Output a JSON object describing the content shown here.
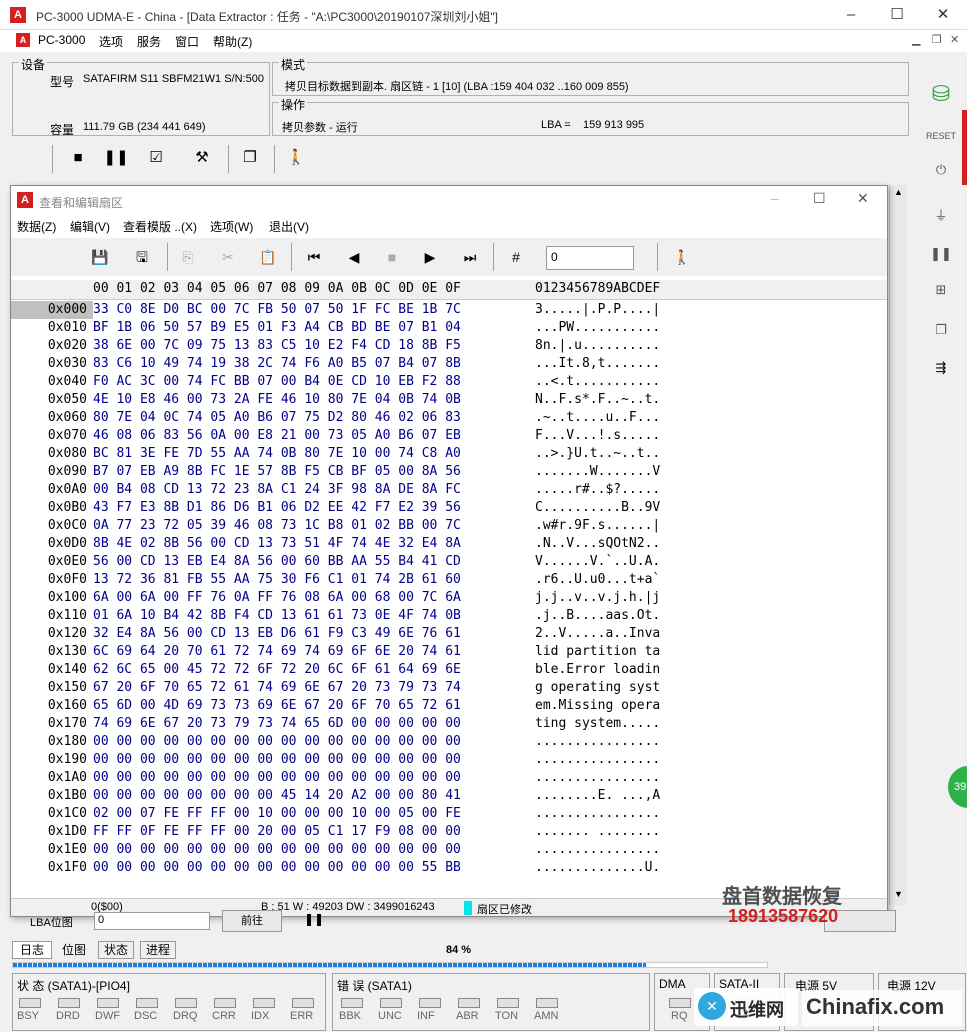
{
  "window": {
    "title": "PC-3000 UDMA-E - China - [Data Extractor : 任务 - \"A:\\PC3000\\20190107深圳刘小姐\"]",
    "logo": "A"
  },
  "menu": {
    "app": "PC-3000",
    "items": [
      "选项",
      "服务",
      "窗口",
      "帮助(Z)"
    ]
  },
  "device": {
    "label": "设备",
    "model_label": "型号",
    "model": "SATAFIRM   S11 SBFM21W1 S/N:500",
    "capacity_label": "容量",
    "capacity": "111.79 GB (234 441 649)"
  },
  "mode": {
    "label": "模式",
    "text": "拷贝目标数据到副本. 扇区链 - 1 [10] (LBA :159 404 032 ..160 009 855)"
  },
  "operation": {
    "label": "操作",
    "text": "拷贝参数 - 运行",
    "lba_label": "LBA =",
    "lba": "159 913 995"
  },
  "editor": {
    "title": "查看和编辑扇区",
    "menu": [
      "数据(Z)",
      "编辑(V)",
      "查看模版 ..(X)",
      "选项(W)",
      "退出(V)"
    ],
    "sector_input": "0",
    "header_hex": "00 01 02 03 04 05 06 07 08 09 0A 0B 0C 0D 0E 0F",
    "header_ascii": "0123456789ABCDEF",
    "rows": [
      {
        "off": "0x000",
        "hex": "33 C0 8E D0 BC 00 7C FB 50 07 50 1F FC BE 1B 7C",
        "ascii": "3.....|.P.P....|"
      },
      {
        "off": "0x010",
        "hex": "BF 1B 06 50 57 B9 E5 01 F3 A4 CB BD BE 07 B1 04",
        "ascii": "...PW..........."
      },
      {
        "off": "0x020",
        "hex": "38 6E 00 7C 09 75 13 83 C5 10 E2 F4 CD 18 8B F5",
        "ascii": "8n.|.u.........."
      },
      {
        "off": "0x030",
        "hex": "83 C6 10 49 74 19 38 2C 74 F6 A0 B5 07 B4 07 8B",
        "ascii": "...It.8,t......."
      },
      {
        "off": "0x040",
        "hex": "F0 AC 3C 00 74 FC BB 07 00 B4 0E CD 10 EB F2 88",
        "ascii": "..<.t..........."
      },
      {
        "off": "0x050",
        "hex": "4E 10 E8 46 00 73 2A FE 46 10 80 7E 04 0B 74 0B",
        "ascii": "N..F.s*.F..~..t."
      },
      {
        "off": "0x060",
        "hex": "80 7E 04 0C 74 05 A0 B6 07 75 D2 80 46 02 06 83",
        "ascii": ".~..t....u..F..."
      },
      {
        "off": "0x070",
        "hex": "46 08 06 83 56 0A 00 E8 21 00 73 05 A0 B6 07 EB",
        "ascii": "F...V...!.s....."
      },
      {
        "off": "0x080",
        "hex": "BC 81 3E FE 7D 55 AA 74 0B 80 7E 10 00 74 C8 A0",
        "ascii": "..>.}U.t..~..t.."
      },
      {
        "off": "0x090",
        "hex": "B7 07 EB A9 8B FC 1E 57 8B F5 CB BF 05 00 8A 56",
        "ascii": ".......W.......V"
      },
      {
        "off": "0x0A0",
        "hex": "00 B4 08 CD 13 72 23 8A C1 24 3F 98 8A DE 8A FC",
        "ascii": ".....r#..$?....."
      },
      {
        "off": "0x0B0",
        "hex": "43 F7 E3 8B D1 86 D6 B1 06 D2 EE 42 F7 E2 39 56",
        "ascii": "C..........B..9V"
      },
      {
        "off": "0x0C0",
        "hex": "0A 77 23 72 05 39 46 08 73 1C B8 01 02 BB 00 7C",
        "ascii": ".w#r.9F.s......|"
      },
      {
        "off": "0x0D0",
        "hex": "8B 4E 02 8B 56 00 CD 13 73 51 4F 74 4E 32 E4 8A",
        "ascii": ".N..V...sQOtN2.."
      },
      {
        "off": "0x0E0",
        "hex": "56 00 CD 13 EB E4 8A 56 00 60 BB AA 55 B4 41 CD",
        "ascii": "V......V.`..U.A."
      },
      {
        "off": "0x0F0",
        "hex": "13 72 36 81 FB 55 AA 75 30 F6 C1 01 74 2B 61 60",
        "ascii": ".r6..U.u0...t+a`"
      },
      {
        "off": "0x100",
        "hex": "6A 00 6A 00 FF 76 0A FF 76 08 6A 00 68 00 7C 6A",
        "ascii": "j.j..v..v.j.h.|j"
      },
      {
        "off": "0x110",
        "hex": "01 6A 10 B4 42 8B F4 CD 13 61 61 73 0E 4F 74 0B",
        "ascii": ".j..B....aas.Ot."
      },
      {
        "off": "0x120",
        "hex": "32 E4 8A 56 00 CD 13 EB D6 61 F9 C3 49 6E 76 61",
        "ascii": "2..V.....a..Inva"
      },
      {
        "off": "0x130",
        "hex": "6C 69 64 20 70 61 72 74 69 74 69 6F 6E 20 74 61",
        "ascii": "lid partition ta"
      },
      {
        "off": "0x140",
        "hex": "62 6C 65 00 45 72 72 6F 72 20 6C 6F 61 64 69 6E",
        "ascii": "ble.Error loadin"
      },
      {
        "off": "0x150",
        "hex": "67 20 6F 70 65 72 61 74 69 6E 67 20 73 79 73 74",
        "ascii": "g operating syst"
      },
      {
        "off": "0x160",
        "hex": "65 6D 00 4D 69 73 73 69 6E 67 20 6F 70 65 72 61",
        "ascii": "em.Missing opera"
      },
      {
        "off": "0x170",
        "hex": "74 69 6E 67 20 73 79 73 74 65 6D 00 00 00 00 00",
        "ascii": "ting system....."
      },
      {
        "off": "0x180",
        "hex": "00 00 00 00 00 00 00 00 00 00 00 00 00 00 00 00",
        "ascii": "................"
      },
      {
        "off": "0x190",
        "hex": "00 00 00 00 00 00 00 00 00 00 00 00 00 00 00 00",
        "ascii": "................"
      },
      {
        "off": "0x1A0",
        "hex": "00 00 00 00 00 00 00 00 00 00 00 00 00 00 00 00",
        "ascii": "................"
      },
      {
        "off": "0x1B0",
        "hex": "00 00 00 00 00 00 00 00 45 14 20 A2 00 00 80 41",
        "ascii": "........E. ...,A"
      },
      {
        "off": "0x1C0",
        "hex": "02 00 07 FE FF FF 00 10 00 00 00 10 00 05 00 FE",
        "ascii": "................"
      },
      {
        "off": "0x1D0",
        "hex": "FF FF 0F FE FF FF 00 20 00 05 C1 17 F9 08 00 00",
        "ascii": "....... ........"
      },
      {
        "off": "0x1E0",
        "hex": "00 00 00 00 00 00 00 00 00 00 00 00 00 00 00 00",
        "ascii": "................"
      },
      {
        "off": "0x1F0",
        "hex": "00 00 00 00 00 00 00 00 00 00 00 00 00 00 55 BB",
        "ascii": "..............U."
      }
    ],
    "status_pos": "0($00)",
    "status_b": "B : 51 W : 49203 DW : 3499016243",
    "status_mod": "扇区已修改"
  },
  "lba_pos": {
    "label": "LBA位图",
    "value": "0",
    "btn": "前往"
  },
  "watermark": {
    "line1": "盘首数据恢复",
    "line2": "18913587620",
    "side": "39"
  },
  "tabs": [
    "日志",
    "位图",
    "状态",
    "进程"
  ],
  "progress": {
    "value": 0.84,
    "text": "84 %"
  },
  "status": {
    "ata_label": "状 态 (SATA1)-[PIO4]",
    "ata_leds": [
      "BSY",
      "DRD",
      "DWF",
      "DSC",
      "DRQ",
      "CRR",
      "IDX",
      "ERR"
    ],
    "err_label": "错 误 (SATA1)",
    "err_leds": [
      "BBK",
      "UNC",
      "INF",
      "ABR",
      "TON",
      "AMN"
    ],
    "dma": "DMA",
    "dma_led": "RQ",
    "sata2": "SATA-II",
    "p5": "电源 5V",
    "p12": "电源 12V"
  },
  "logos": {
    "xunwei": "迅维网",
    "chinafix": "Chinafix.com"
  },
  "colors": {
    "hex": "#00008b",
    "accent": "#d42020",
    "progress": "#1e7be0"
  }
}
